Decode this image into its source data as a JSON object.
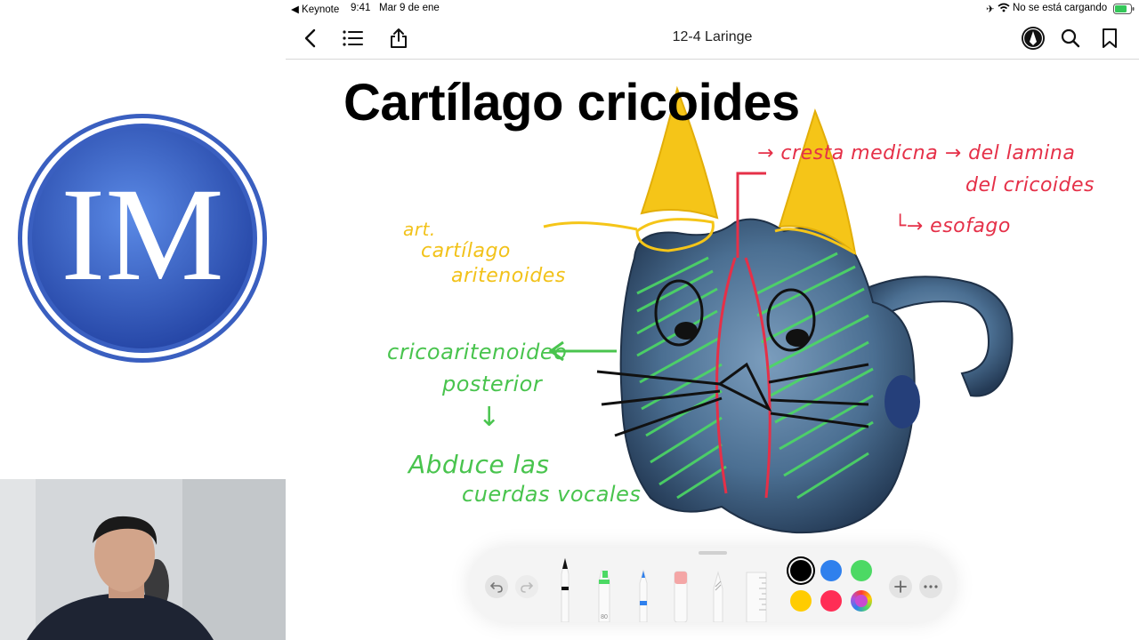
{
  "colors": {
    "logo_blue": "#3d6fd0",
    "annotation_yellow": "#f2c21a",
    "annotation_green": "#49c44e",
    "annotation_red": "#e53048",
    "cartilage_blue": "#4a6f93"
  },
  "logo": {
    "text": "IM"
  },
  "webcam": {
    "description_icon": "presenter-video-icon"
  },
  "status_bar": {
    "back_app": "◀ Keynote",
    "time": "9:41",
    "date": "Mar 9 de ene",
    "battery_text": "No se está cargando"
  },
  "nav": {
    "title": "12-4 Laringe",
    "back_icon": "chevron-left-icon",
    "list_icon": "list-icon",
    "share_icon": "share-icon",
    "markup_icon": "pen-circle-icon",
    "search_icon": "search-icon",
    "bookmark_icon": "bookmark-icon"
  },
  "slide": {
    "title": "Cartílago cricoides"
  },
  "annotations": {
    "yellow_1": "art.",
    "yellow_2": "cartílago",
    "yellow_3": "aritenoides",
    "green_1": "cricoaritenoideo",
    "green_2": "posterior",
    "green_arrow": "↓",
    "green_3": "Abduce las",
    "green_4": "cuerdas vocales",
    "red_1": "→ cresta medicna → del lamina",
    "red_2": "del cricoides",
    "red_3": "└→ esofago"
  },
  "toolbar": {
    "undo_icon": "undo-icon",
    "redo_icon": "redo-icon",
    "tools": [
      "pen",
      "marker",
      "pencil-blue",
      "eraser",
      "lasso",
      "ruler"
    ],
    "marker_width": "80",
    "swatches": [
      "#000000",
      "#2f80ed",
      "#4cd964",
      "#ffcc00",
      "#ff2d55",
      "multicolor"
    ],
    "add_icon": "plus-icon",
    "more_icon": "more-icon"
  }
}
